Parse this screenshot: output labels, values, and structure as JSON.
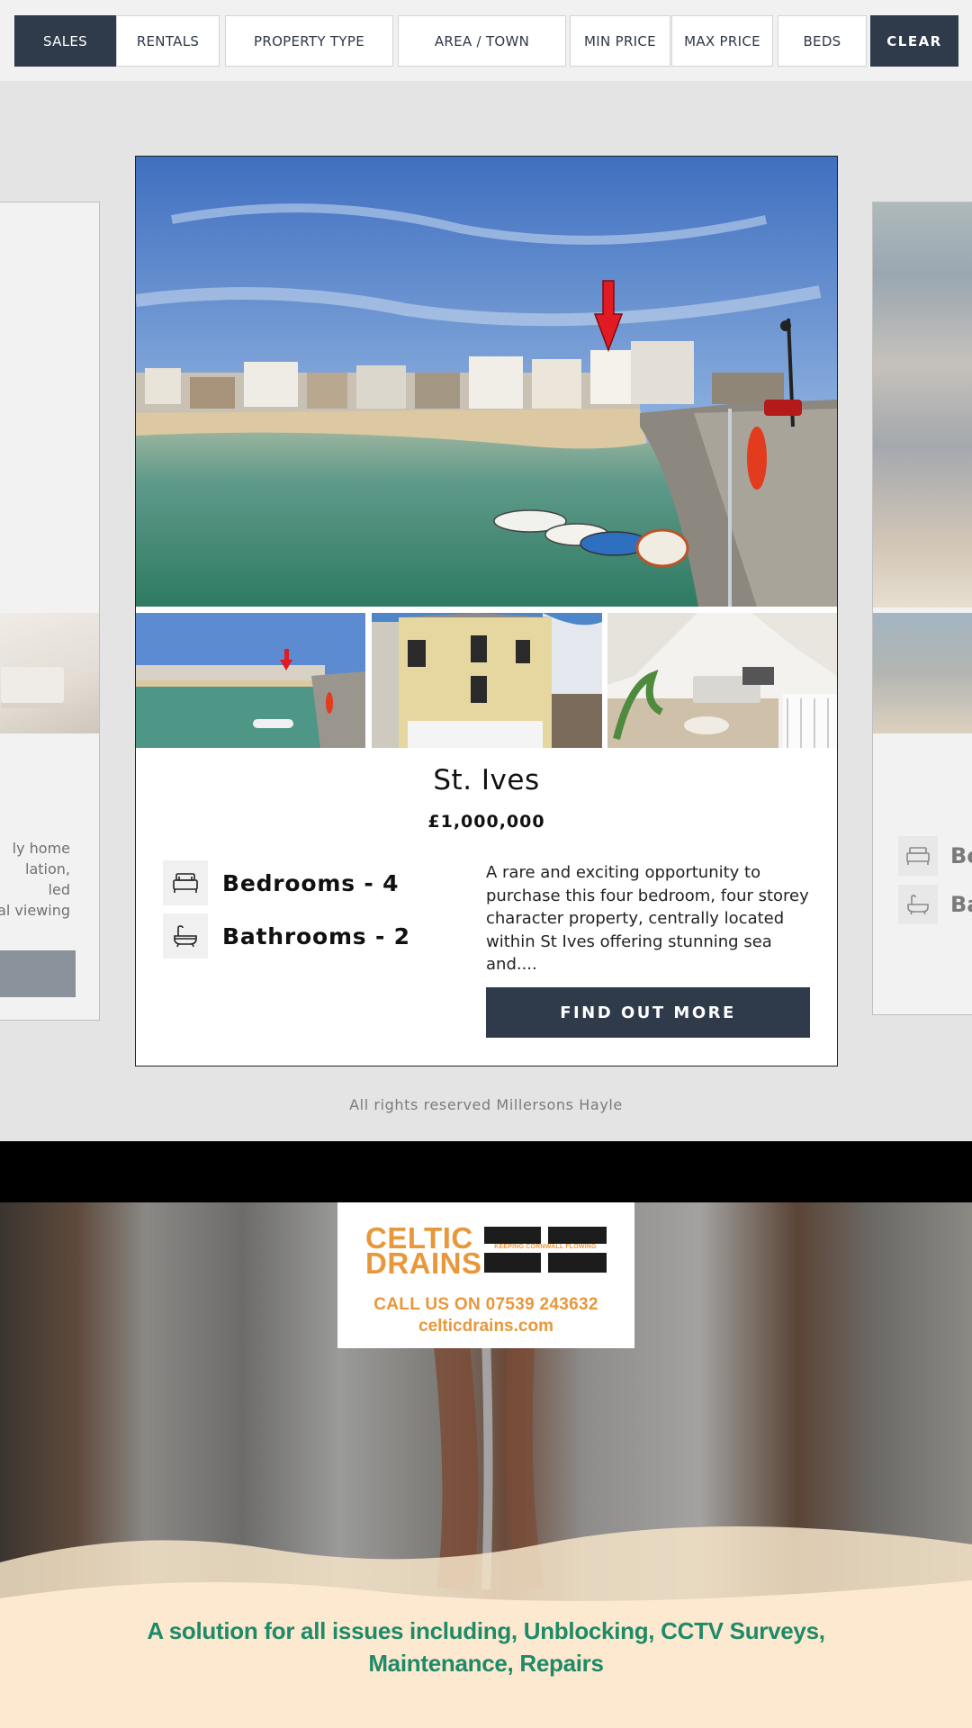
{
  "filters": [
    {
      "label": "Sales",
      "active": true
    },
    {
      "label": "Rentals",
      "active": false
    },
    {
      "label": "Property Type",
      "active": false
    },
    {
      "label": "Area / Town",
      "active": false
    },
    {
      "label": "Min Price",
      "active": false
    },
    {
      "label": "Max Price",
      "active": false
    },
    {
      "label": "Beds",
      "active": false
    }
  ],
  "clear_label": "CLEAR",
  "left_card": {
    "description_fragments": [
      "ly home",
      "lation,",
      "led",
      "al viewing"
    ]
  },
  "right_card": {
    "features": [
      "Be",
      "Ba"
    ],
    "icons": [
      "bed-icon",
      "bath-icon"
    ]
  },
  "property": {
    "title": "St. Ives",
    "price": "£1,000,000",
    "bedrooms": "Bedrooms - 4",
    "bathrooms": "Bathrooms - 2",
    "description": "A rare and exciting opportunity to purchase this four bedroom, four storey character property, centrally located within St Ives offering stunning sea and....",
    "cta": "FIND OUT MORE",
    "icons": {
      "bedrooms": "bed-icon",
      "bathrooms": "bath-icon"
    }
  },
  "footer": {
    "copyright": "All rights reserved Millersons Hayle"
  },
  "ad": {
    "brand_line1": "CELTIC",
    "brand_line2": "DRAINS",
    "strapline": "KEEPING CORNWALL FLOWING",
    "call": "CALL US ON 07539 243632",
    "url": "celticdrains.com",
    "tagline_line1": "A solution for all issues including, Unblocking, CCTV Surveys,",
    "tagline_line2": "Maintenance, Repairs"
  },
  "colors": {
    "navy": "#2f3a4b",
    "ad_orange": "#e8973a",
    "ad_green": "#1e8a68"
  }
}
